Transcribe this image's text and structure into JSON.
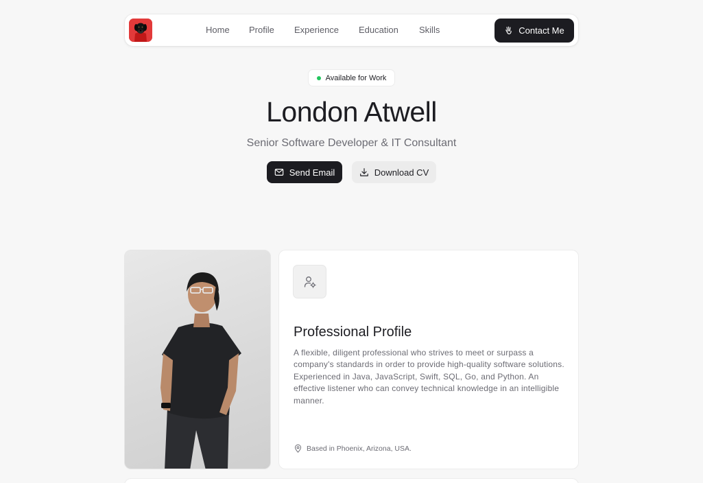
{
  "nav": {
    "links": [
      "Home",
      "Profile",
      "Experience",
      "Education",
      "Skills"
    ],
    "contact_label": "Contact Me"
  },
  "hero": {
    "badge": "Available for Work",
    "name": "London Atwell",
    "subtitle": "Senior Software Developer & IT Consultant",
    "send_email_label": "Send Email",
    "download_cv_label": "Download CV"
  },
  "profile": {
    "title": "Professional Profile",
    "description": "A flexible, diligent professional who strives to meet or surpass a company's standards in order to provide high-quality software solutions. Experienced in Java, JavaScript, Swift, SQL, Go, and Python. An effective listener who can convey technical knowledge in an intelligible manner.",
    "location": "Based in Phoenix, Arizona, USA."
  },
  "colors": {
    "background": "#f7f7f7",
    "primary_button": "#1c1c21",
    "status_dot": "#22c55e",
    "logo_bg": "#e23a3a"
  },
  "icons": {
    "logo": "dog-avatar-logo",
    "contact": "hand-wave-icon",
    "send_email": "mail-icon",
    "download_cv": "download-icon",
    "profile": "user-cog-icon",
    "location": "map-pin-icon"
  }
}
